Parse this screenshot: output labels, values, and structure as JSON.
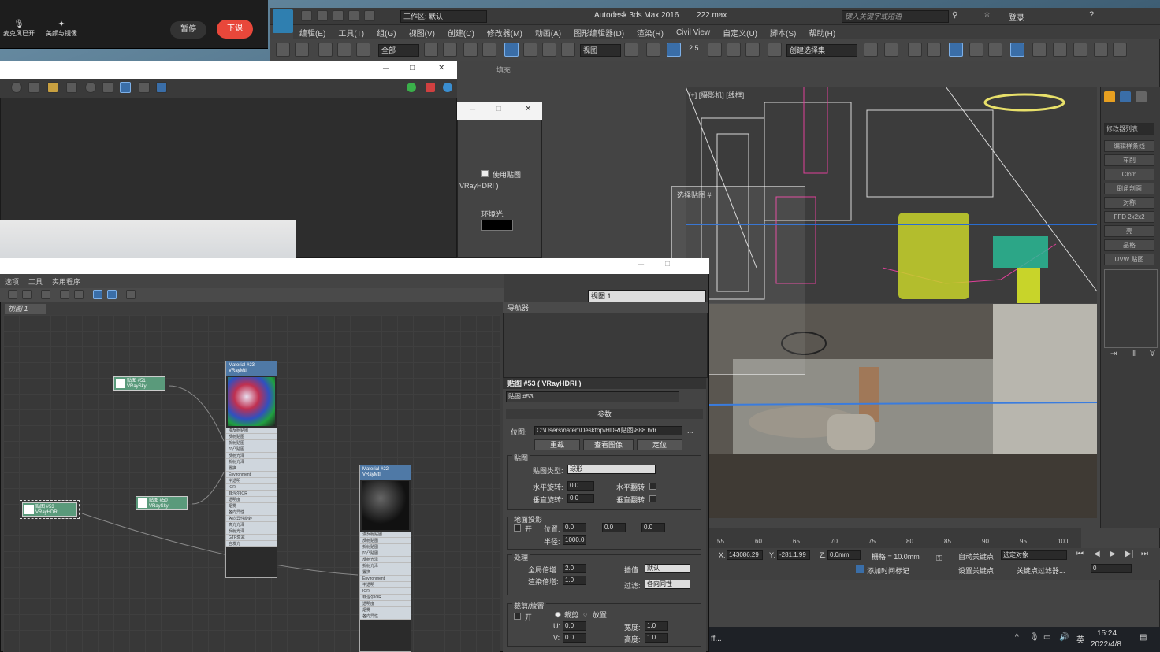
{
  "recorder": {
    "mic_label": "麦克风已开",
    "beauty_label": "美颜与镜像",
    "pause_label": "暂停",
    "stop_label": "下课"
  },
  "app": {
    "title": "Autodesk 3ds Max 2016",
    "file": "222.max",
    "workspace": "工作区: 默认",
    "search_placeholder": "键入关键字或短语",
    "login": "登录",
    "menus": [
      "编辑(E)",
      "工具(T)",
      "组(G)",
      "视图(V)",
      "创建(C)",
      "修改器(M)",
      "动画(A)",
      "图形编辑器(D)",
      "渲染(R)",
      "Civil View",
      "自定义(U)",
      "脚本(S)",
      "帮助(H)"
    ],
    "filter_all": "全部",
    "ref_coord": "视图",
    "selection_set": "创建选择集",
    "toolbar_numbers": "2.5",
    "hint_tab": "填充"
  },
  "viewport_top": {
    "label": "[+] [摄影机] [线框]"
  },
  "command_panel": {
    "modifier_list": "修改器列表",
    "buttons": [
      "编辑样条线",
      "车削",
      "Cloth",
      "倒角剖面",
      "对称",
      "FFD 2x2x2",
      "壳",
      "晶格",
      "UVW 贴图"
    ]
  },
  "timeline": {
    "ticks": [
      "55",
      "60",
      "65",
      "70",
      "75",
      "80",
      "85",
      "90",
      "95",
      "100"
    ]
  },
  "status": {
    "x_label": "X:",
    "x_value": "143086.29",
    "y_label": "Y:",
    "y_value": "-281.1.99",
    "z_label": "Z:",
    "z_value": "0.0mm",
    "grid": "栅格 = 10.0mm",
    "auto_key": "自动关键点",
    "selected": "选定对象",
    "set_key": "设置关键点",
    "key_filter": "关键点过滤器...",
    "add_time_tag": "添加时间标记",
    "frame": "0"
  },
  "taskbar": {
    "ime": "英",
    "time": "15:24",
    "date": "2022/4/8",
    "left_text": "ff..."
  },
  "env_dialog": {
    "use_map": "使用贴图",
    "map_name": "VRayHDRI )",
    "ambient": "环境光:",
    "floating_label": "选择贴图 #"
  },
  "slate": {
    "menus": [
      "选项",
      "工具",
      "实用程序"
    ],
    "view_tab": "视图 1",
    "view_combo": "视图 1",
    "navigator": "导航器",
    "nodes": {
      "mat23_title": "Material #23",
      "mat23_type": "VRayMtl",
      "mat22_title": "Material #22",
      "mat22_type": "VRayMtl",
      "map51": "贴图 #51",
      "map51_type": "VRaySky",
      "map50": "贴图 #50",
      "map50_type": "VRaySky",
      "map53": "贴图 #53",
      "map53_type": "VRayHDRI",
      "slots": [
        "漫反射贴图",
        "反射贴图",
        "折射贴图",
        "凹凸贴图",
        "反射光泽",
        "折射光泽",
        "置换",
        "Environment",
        "半透明",
        "IOR",
        "菲涅尔IOR",
        "透明度",
        "烟雾",
        "各向异性",
        "各向异性旋转",
        "高光光泽",
        "反射光泽",
        "GTR衰减",
        "自发光"
      ]
    }
  },
  "params": {
    "header": "贴图 #53 ( VRayHDRI )",
    "name": "贴图 #53",
    "rollout": "参数",
    "bitmap_label": "位图:",
    "bitmap_path": "C:\\Users\\nafen\\Desktop\\HDRI贴图\\888.hdr",
    "reload": "重载",
    "view_image": "查看图像",
    "locate": "定位",
    "map_group": "贴图",
    "map_type_label": "贴图类型:",
    "map_type": "球形",
    "h_rot_label": "水平旋转:",
    "h_rot": "0.0",
    "h_flip": "水平翻转",
    "v_rot_label": "垂直旋转:",
    "v_rot": "0.0",
    "v_flip": "垂直翻转",
    "ground_group": "地面投影",
    "on": "开",
    "pos_label": "位置:",
    "pos_x": "0.0",
    "pos_y": "0.0",
    "pos_z": "0.0",
    "radius_label": "半径:",
    "radius": "1000.0",
    "process_group": "处理",
    "overall_mult_label": "全局倍增:",
    "overall_mult": "2.0",
    "render_mult_label": "渲染倍增:",
    "render_mult": "1.0",
    "interp_label": "插值:",
    "interp": "默认",
    "filter_label": "过滤:",
    "filter": "各向同性",
    "crop_group": "裁剪/放置",
    "crop_on": "开",
    "crop": "裁剪",
    "place": "放置",
    "u_label": "U:",
    "u": "0.0",
    "v_label": "V:",
    "v": "0.0",
    "w_label": "宽度:",
    "w": "1.0",
    "h_label": "高度:",
    "h": "1.0"
  }
}
